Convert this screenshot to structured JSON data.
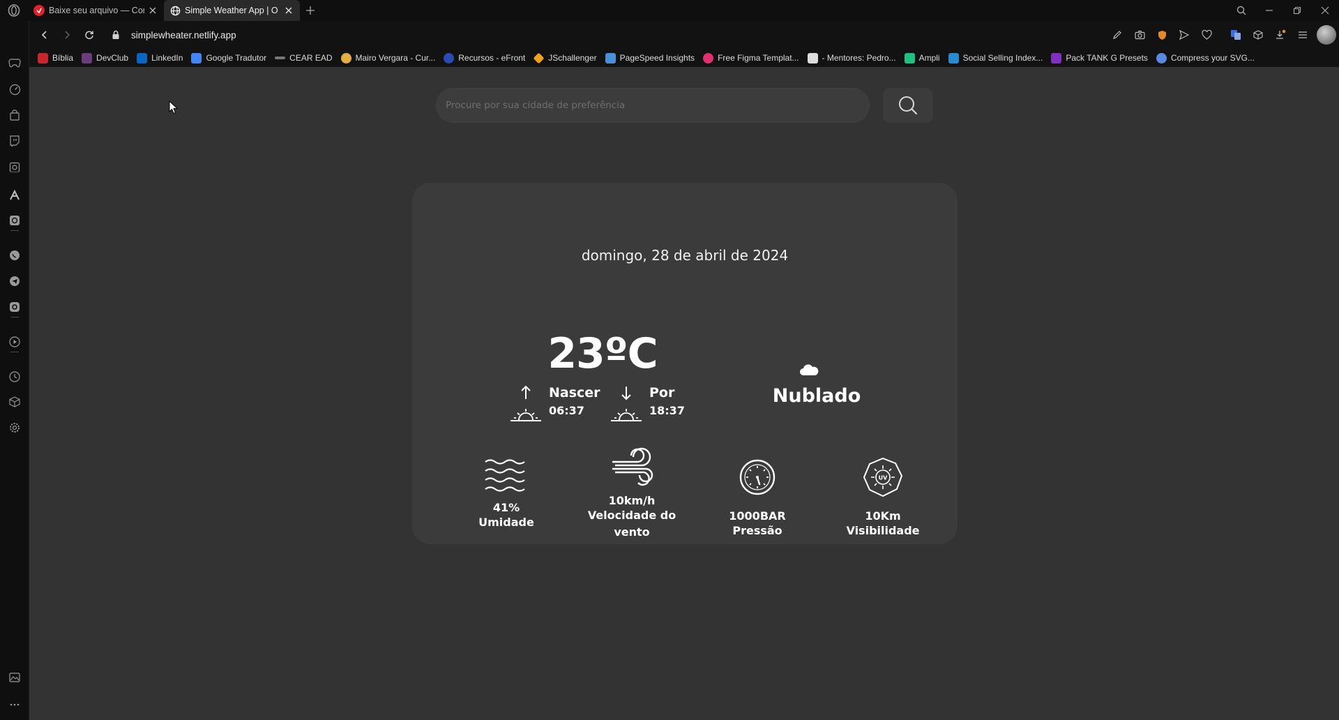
{
  "browser": {
    "tabs": [
      {
        "label": "Baixe seu arquivo — Conve",
        "favicon": "red-favicon-icon",
        "color": "#e0202a"
      },
      {
        "label": "Simple Weather App | O Se",
        "favicon": "globe-icon",
        "color": "#ffffff"
      }
    ],
    "url_domain": "simplewheater.netlify.app"
  },
  "bookmarks": [
    {
      "label": "Bíblia",
      "color": "#c8252f"
    },
    {
      "label": "DevClub",
      "color": "#6a3d7a"
    },
    {
      "label": "LinkedIn",
      "color": "#0a66c2"
    },
    {
      "label": "Google Tradutor",
      "color": "#4285f4"
    },
    {
      "label": "CEAR EAD",
      "color": "#777777"
    },
    {
      "label": "Mairo Vergara - Cur...",
      "color": "#e0b040"
    },
    {
      "label": "Recursos - eFront",
      "color": "#2a4bb0"
    },
    {
      "label": "JSchallenger",
      "color": "#f0a020"
    },
    {
      "label": "PageSpeed Insights",
      "color": "#4a90d9"
    },
    {
      "label": "Free Figma Templat...",
      "color": "#e03070"
    },
    {
      "label": "- Mentores: Pedro...",
      "color": "#dddddd"
    },
    {
      "label": "Ampli",
      "color": "#20c080"
    },
    {
      "label": "Social Selling Index...",
      "color": "#2a8ad0"
    },
    {
      "label": "Pack TANK G Presets",
      "color": "#8030c0"
    },
    {
      "label": "Compress your SVG...",
      "color": "#5a8ae0"
    }
  ],
  "search": {
    "placeholder": "Procure por sua cidade de preferência"
  },
  "weather": {
    "date": "domingo, 28 de abril de 2024",
    "temperature": "23ºC",
    "sunrise_label": "Nascer",
    "sunrise_time": "06:37",
    "sunset_label": "Por",
    "sunset_time": "18:37",
    "condition": "Nublado",
    "condition_icon": "cloud-icon",
    "stats": [
      {
        "value": "41%",
        "label": "Umidade",
        "icon": "waves-icon"
      },
      {
        "value": "10km/h",
        "label": "Velocidade do vento",
        "icon": "wind-icon"
      },
      {
        "value": "1000BAR",
        "label": "Pressão",
        "icon": "gauge-icon"
      },
      {
        "value": "10Km",
        "label": "Visibilidade",
        "icon": "uv-icon"
      }
    ]
  }
}
